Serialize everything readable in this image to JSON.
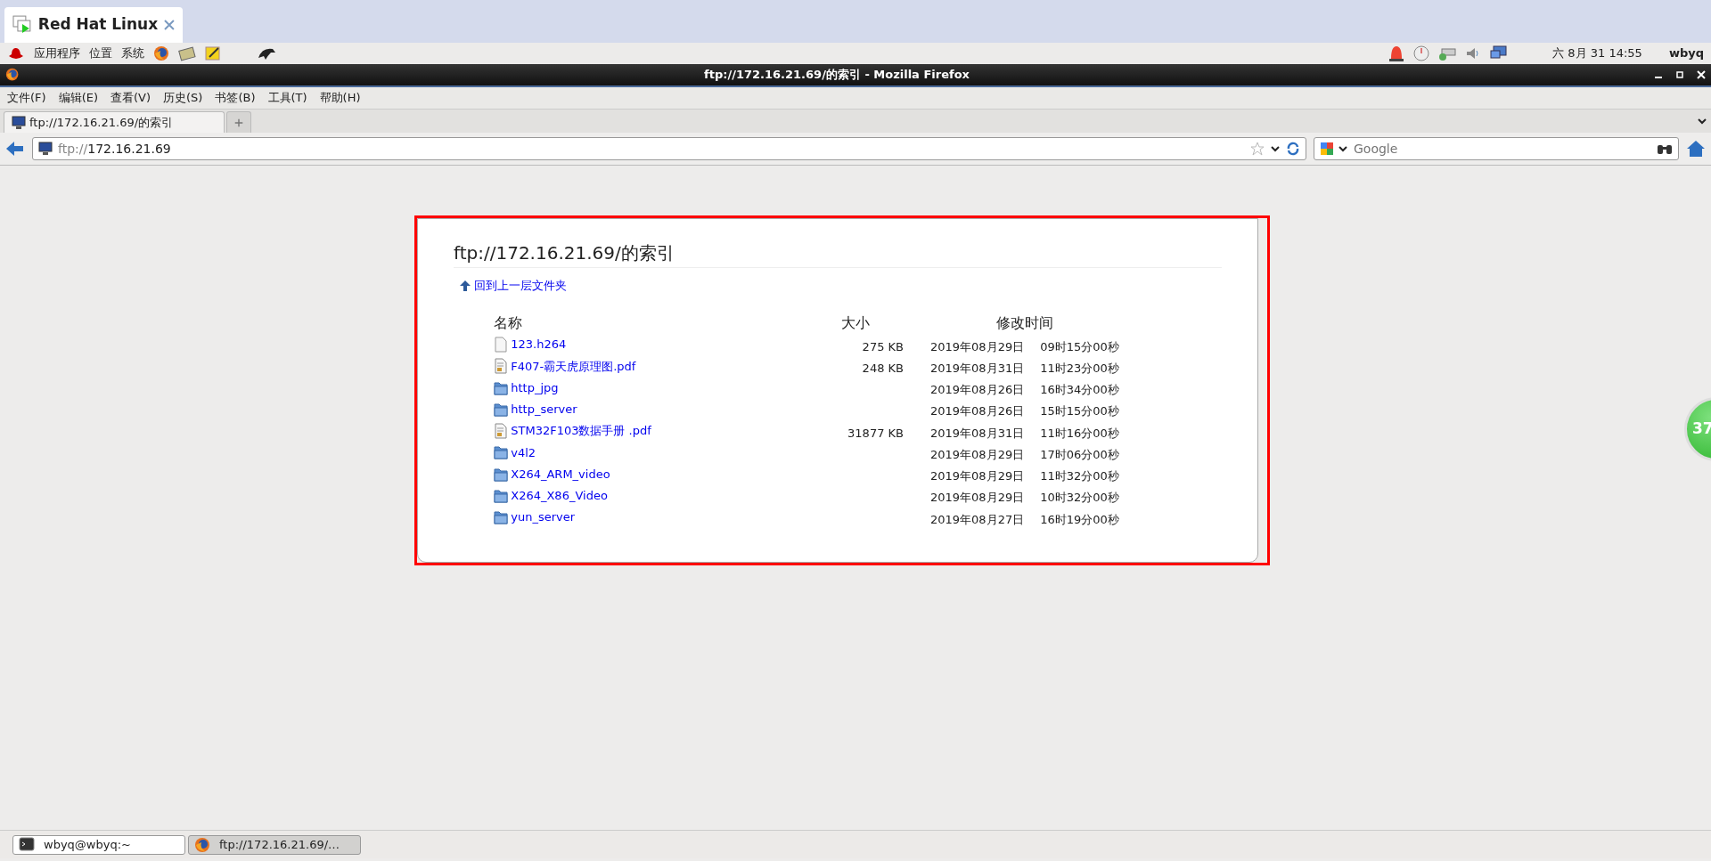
{
  "os_tab": {
    "label": "Red Hat Linux"
  },
  "panel": {
    "menus": [
      "应用程序",
      "位置",
      "系统"
    ],
    "clock": "六 8月 31 14:55",
    "user": "wbyq"
  },
  "window": {
    "title": "ftp://172.16.21.69/的索引 - Mozilla Firefox"
  },
  "menu_bar": [
    "文件(F)",
    "编辑(E)",
    "查看(V)",
    "历史(S)",
    "书签(B)",
    "工具(T)",
    "帮助(H)"
  ],
  "browser_tabs": [
    {
      "label": "ftp://172.16.21.69/的索引",
      "selected": true
    }
  ],
  "address_bar": {
    "scheme": "ftp://",
    "host": "172.16.21.69"
  },
  "search": {
    "placeholder": "Google"
  },
  "listing": {
    "heading": "ftp://172.16.21.69/的索引",
    "parent_link": "回到上一层文件夹",
    "columns": [
      "名称",
      "大小",
      "修改时间"
    ],
    "rows": [
      {
        "kind": "file",
        "name": "123.h264",
        "size": "275 KB",
        "date": "2019年08月29日",
        "time": "09时15分00秒"
      },
      {
        "kind": "pdf",
        "name": "F407-霸天虎原理图.pdf",
        "size": "248 KB",
        "date": "2019年08月31日",
        "time": "11时23分00秒"
      },
      {
        "kind": "folder",
        "name": "http_jpg",
        "date": "2019年08月26日",
        "time": "16时34分00秒"
      },
      {
        "kind": "folder",
        "name": "http_server",
        "date": "2019年08月26日",
        "time": "15时15分00秒"
      },
      {
        "kind": "pdf",
        "name": "STM32F103数据手册 .pdf",
        "size": "31877 KB",
        "date": "2019年08月31日",
        "time": "11时16分00秒"
      },
      {
        "kind": "folder",
        "name": "v4l2",
        "date": "2019年08月29日",
        "time": "17时06分00秒"
      },
      {
        "kind": "folder",
        "name": "X264_ARM_video",
        "date": "2019年08月29日",
        "time": "11时32分00秒"
      },
      {
        "kind": "folder",
        "name": "X264_X86_Video",
        "date": "2019年08月29日",
        "time": "10时32分00秒"
      },
      {
        "kind": "folder",
        "name": "yun_server",
        "date": "2019年08月27日",
        "time": "16时19分00秒"
      }
    ]
  },
  "speed_ball": {
    "value": "37"
  },
  "taskbar": [
    {
      "kind": "terminal",
      "label": "wbyq@wbyq:~",
      "selected": false
    },
    {
      "kind": "browser",
      "label": "ftp://172.16.21.69/…",
      "selected": true
    }
  ]
}
